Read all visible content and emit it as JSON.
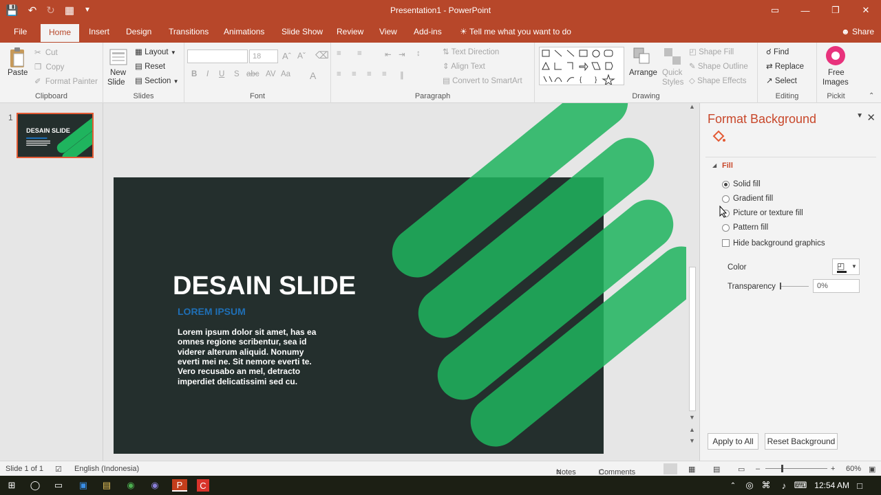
{
  "app": {
    "window_title": "Presentation1 - PowerPoint"
  },
  "tabs": [
    {
      "label": "File"
    },
    {
      "label": "Home"
    },
    {
      "label": "Insert"
    },
    {
      "label": "Design"
    },
    {
      "label": "Transitions"
    },
    {
      "label": "Animations"
    },
    {
      "label": "Slide Show"
    },
    {
      "label": "Review"
    },
    {
      "label": "View"
    },
    {
      "label": "Add-ins"
    }
  ],
  "tell_me": "Tell me what you want to do",
  "share": "Share",
  "ribbon": {
    "clipboard": {
      "paste": "Paste",
      "cut": "Cut",
      "copy": "Copy",
      "format_painter": "Format Painter",
      "label": "Clipboard"
    },
    "slides": {
      "new_slide_1": "New",
      "new_slide_2": "Slide",
      "layout": "Layout",
      "reset": "Reset",
      "section": "Section",
      "label": "Slides"
    },
    "font": {
      "size": "18",
      "label": "Font"
    },
    "paragraph": {
      "text_direction": "Text Direction",
      "align_text": "Align Text",
      "convert_smartart": "Convert to SmartArt",
      "label": "Paragraph"
    },
    "drawing": {
      "arrange": "Arrange",
      "quick_styles_1": "Quick",
      "quick_styles_2": "Styles",
      "shape_fill": "Shape Fill",
      "shape_outline": "Shape Outline",
      "shape_effects": "Shape Effects",
      "label": "Drawing"
    },
    "editing": {
      "find": "Find",
      "replace": "Replace",
      "select": "Select",
      "label": "Editing"
    },
    "pickit": {
      "free_1": "Free",
      "free_2": "Images",
      "label": "Pickit"
    }
  },
  "thumbnails": [
    {
      "number": "1",
      "title": "DESAIN SLIDE"
    }
  ],
  "slide": {
    "title": "DESAIN SLIDE",
    "subtitle": "LOREM IPSUM",
    "body_lines": [
      "Lorem ipsum dolor sit amet, has ea",
      "omnes regione scribentur, sea id",
      "viderer alterum aliquid. Nonumy",
      "everti mei ne. Sit nemore everti te.",
      "Vero recusabo an mel, detracto",
      "imperdiet delicatissimi sed cu."
    ],
    "bg_color": "#242f2d",
    "accent_color": "#1fb45e",
    "subtitle_color": "#1f6fb5"
  },
  "format_pane": {
    "title": "Format Background",
    "section": "Fill",
    "options": [
      {
        "label": "Solid fill",
        "selected": true
      },
      {
        "label": "Gradient fill",
        "selected": false
      },
      {
        "label": "Picture or texture fill",
        "selected": false
      },
      {
        "label": "Pattern fill",
        "selected": false
      }
    ],
    "hide_bg": "Hide background graphics",
    "color_label": "Color",
    "transparency_label": "Transparency",
    "transparency_value": "0%",
    "apply_all": "Apply to All",
    "reset_bg": "Reset Background"
  },
  "status": {
    "slide_of": "Slide 1 of 1",
    "language": "English (Indonesia)",
    "notes": "Notes",
    "comments": "Comments",
    "zoom": "60%"
  },
  "taskbar": {
    "time": "12:54 AM"
  }
}
